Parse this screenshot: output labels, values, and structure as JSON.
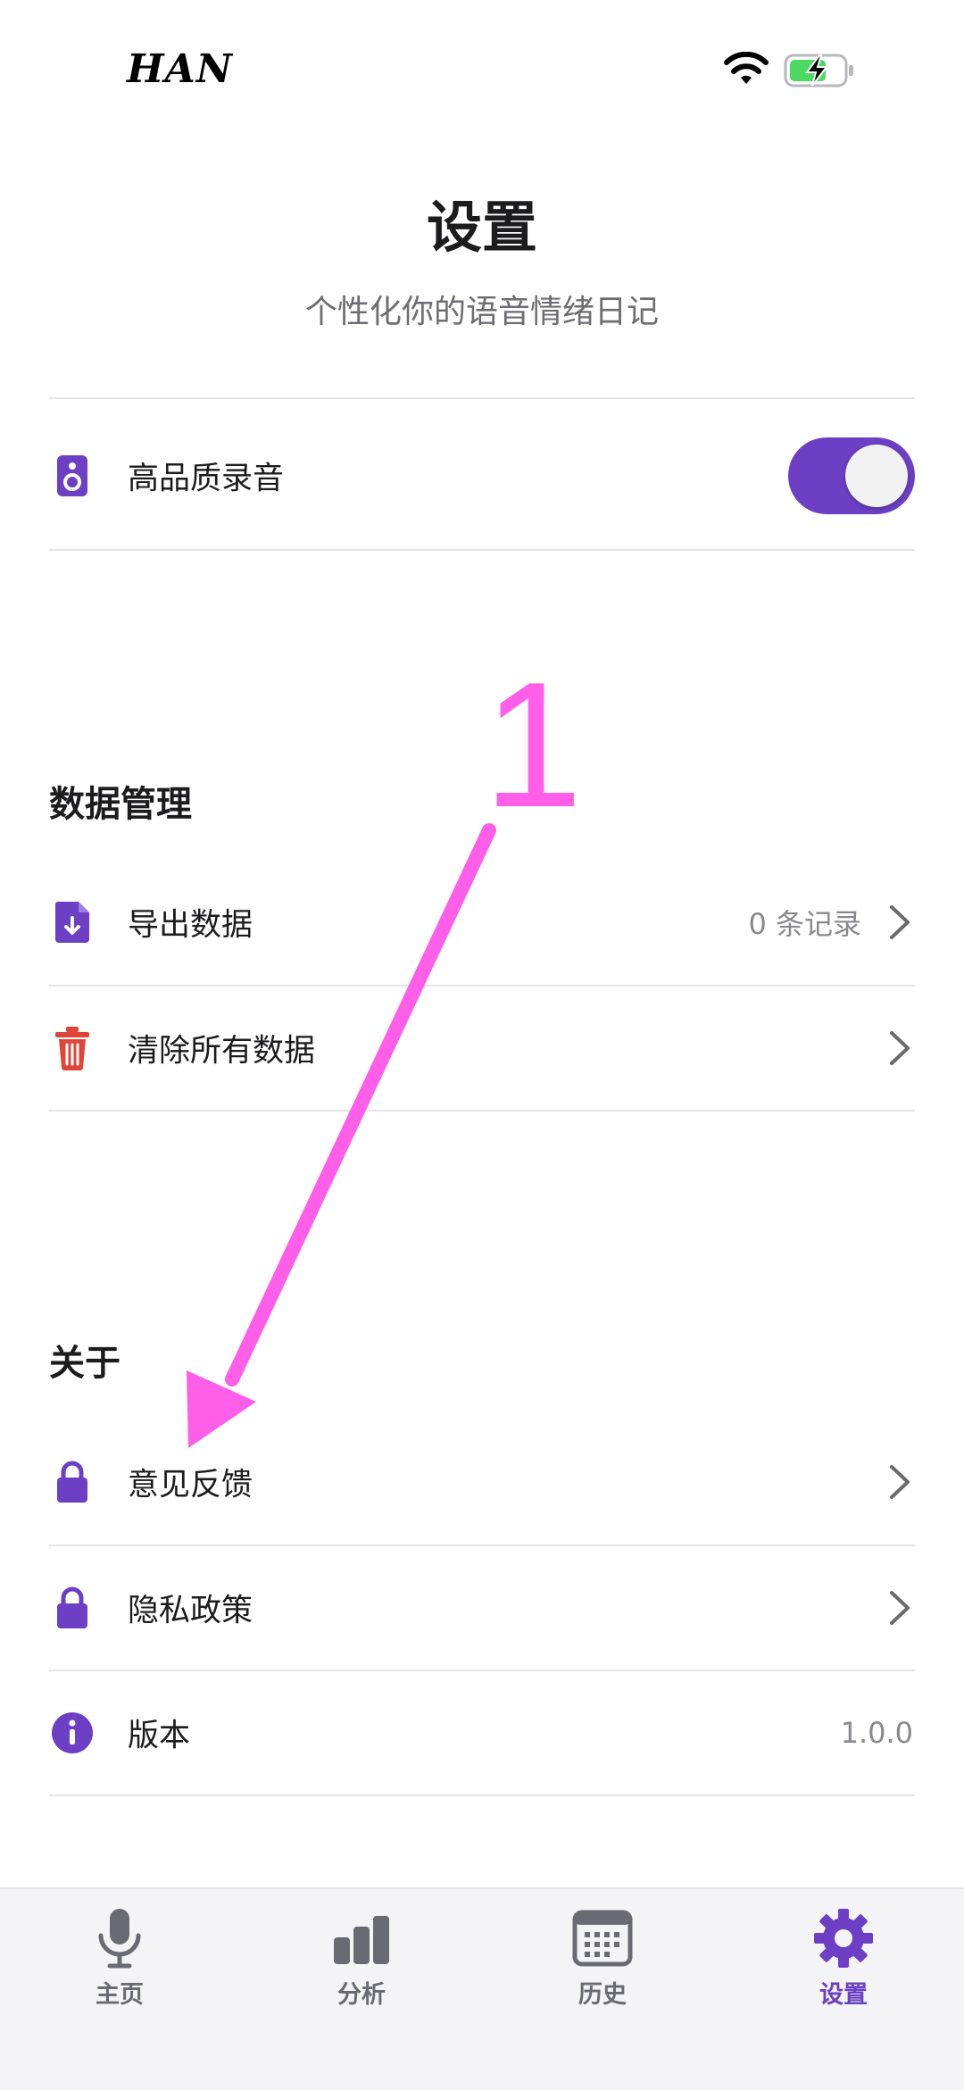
{
  "status_bar": {
    "carrier": "HAN"
  },
  "header": {
    "title": "设置",
    "subtitle": "个性化你的语音情绪日记"
  },
  "settings": {
    "high_quality_recording": {
      "label": "高品质录音",
      "enabled": true
    }
  },
  "data_management": {
    "title": "数据管理",
    "export": {
      "label": "导出数据",
      "value": "0 条记录"
    },
    "clear": {
      "label": "清除所有数据"
    }
  },
  "about": {
    "title": "关于",
    "feedback": {
      "label": "意见反馈"
    },
    "privacy": {
      "label": "隐私政策"
    },
    "version": {
      "label": "版本",
      "value": "1.0.0"
    }
  },
  "tabbar": {
    "items": [
      {
        "label": "主页",
        "icon": "microphone-icon"
      },
      {
        "label": "分析",
        "icon": "bar-chart-icon"
      },
      {
        "label": "历史",
        "icon": "calendar-icon"
      },
      {
        "label": "设置",
        "icon": "gear-icon"
      }
    ],
    "active_index": 3
  },
  "annotation": {
    "marker": "1"
  },
  "colors": {
    "accent": "#6c3fc4",
    "danger": "#e0453a",
    "annotation": "#ff5ee8",
    "battery_charge": "#4cd964"
  }
}
